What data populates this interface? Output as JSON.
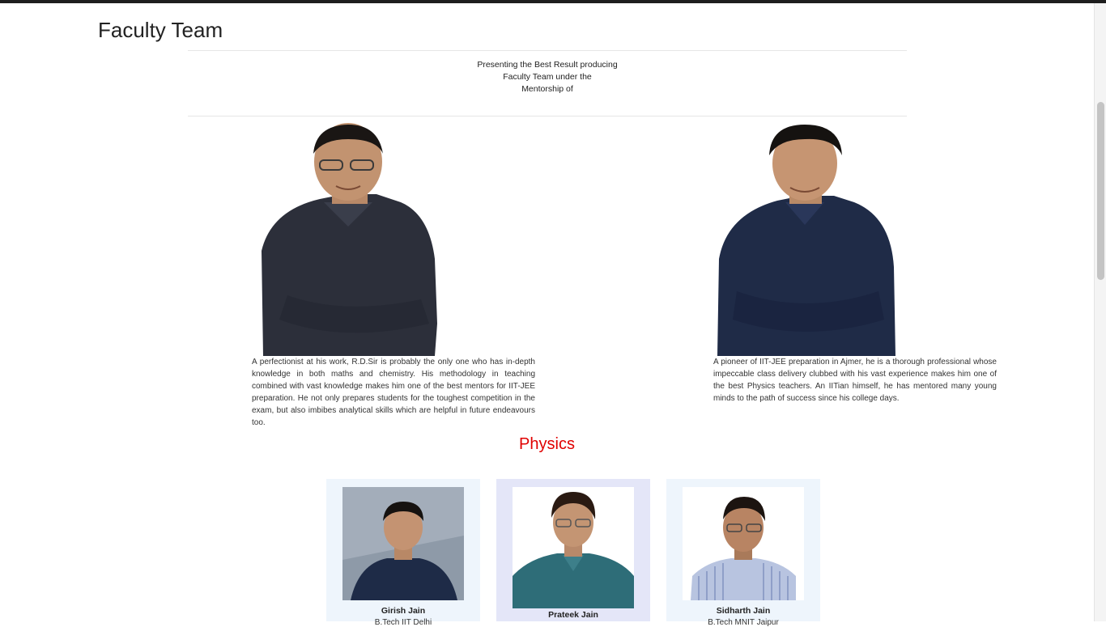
{
  "page": {
    "title": "Faculty Team"
  },
  "intro": {
    "line1": "Presenting the Best Result producing",
    "line2": "Faculty Team under the",
    "line3": "Mentorship of"
  },
  "mentors": [
    {
      "bio": "A perfectionist at his work, R.D.Sir is probably the only one who has in-depth knowledge in both maths and chemistry. His methodology in teaching combined with vast knowledge makes him one of the best mentors for IIT-JEE preparation. He not only prepares students for the toughest competition in the exam, but also imbibes analytical skills which are helpful in future endeavours too."
    },
    {
      "bio": "A pioneer of IIT-JEE preparation in Ajmer, he is a thorough professional whose impeccable class delivery clubbed with his vast experience makes him one of the best Physics teachers. An IITian himself, he has mentored many young minds to the path of success since his college days."
    }
  ],
  "physics": {
    "heading": "Physics",
    "faculty": [
      {
        "name": "Girish Jain",
        "sub": "B.Tech IIT Delhi"
      },
      {
        "name": "Prateek Jain",
        "sub": ""
      },
      {
        "name": "Sidharth Jain",
        "sub": "B.Tech MNIT Jaipur"
      }
    ]
  },
  "colors": {
    "accent": "#e00000",
    "card_bg": "#eef5fc",
    "card_bg_alt": "#e4e6f8"
  }
}
